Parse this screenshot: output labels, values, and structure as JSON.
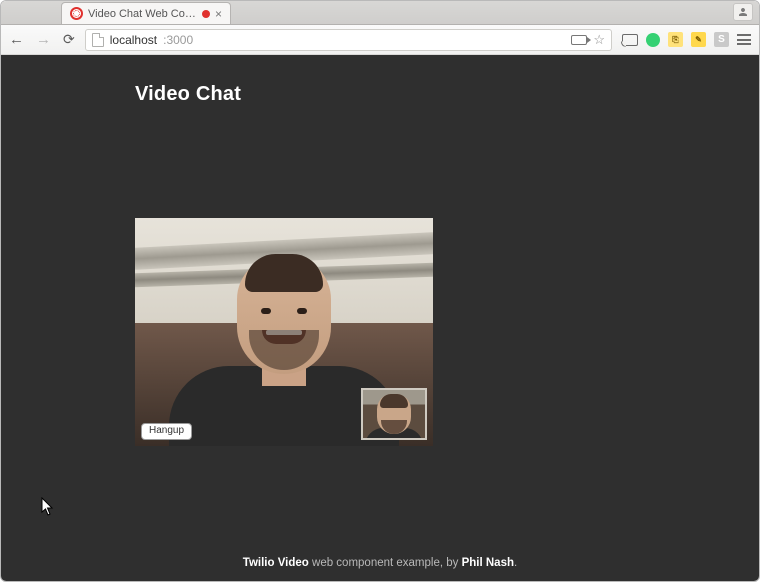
{
  "window": {
    "tab": {
      "title": "Video Chat Web Compo",
      "recording": true
    },
    "url": {
      "host": "localhost",
      "port": ":3000"
    }
  },
  "page": {
    "heading": "Video Chat",
    "hangup_label": "Hangup"
  },
  "footer": {
    "brand": "Twilio Video",
    "middle": " web component example, by ",
    "author": "Phil Nash",
    "suffix": "."
  }
}
